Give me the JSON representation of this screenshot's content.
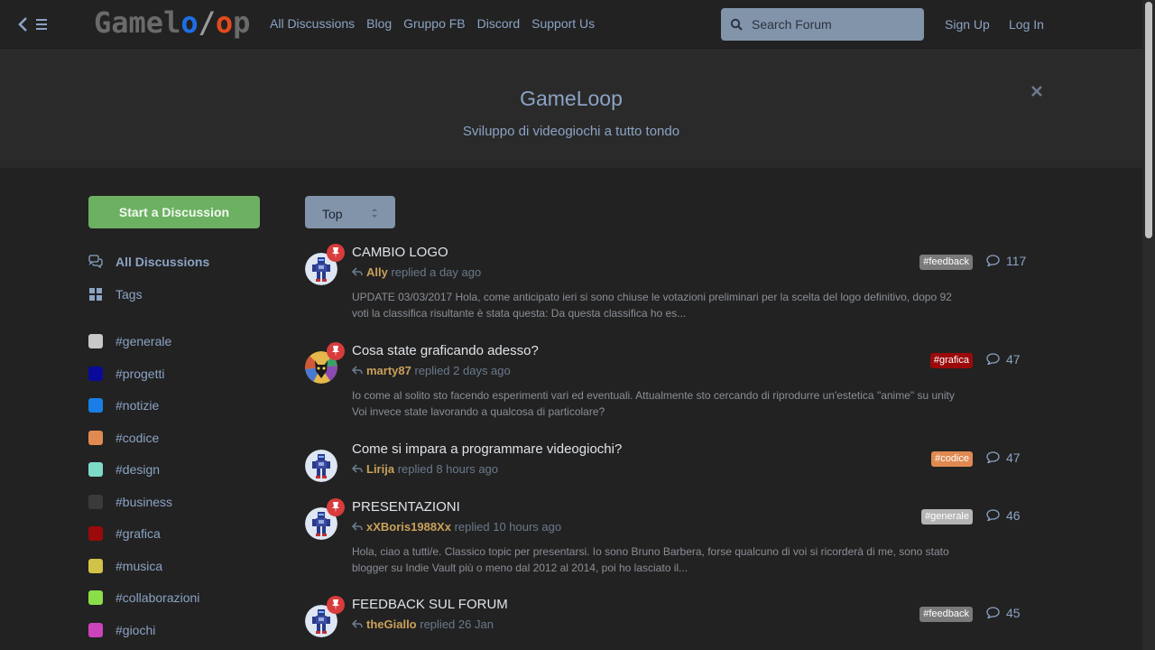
{
  "header": {
    "logo": {
      "part1": "Gamel",
      "o1": "o",
      "slash": "/",
      "o2": "o",
      "part2": "p"
    },
    "nav": [
      "All Discussions",
      "Blog",
      "Gruppo FB",
      "Discord",
      "Support Us"
    ],
    "search_placeholder": "Search Forum",
    "sign_up": "Sign Up",
    "log_in": "Log In"
  },
  "hero": {
    "title": "GameLoop",
    "subtitle": "Sviluppo di videogiochi a tutto tondo"
  },
  "sidebar": {
    "start_label": "Start a Discussion",
    "all_discussions": "All Discussions",
    "tags_label": "Tags",
    "tags": [
      {
        "label": "#generale",
        "color": "#c8c8c8"
      },
      {
        "label": "#progetti",
        "color": "#0a0a9a"
      },
      {
        "label": "#notizie",
        "color": "#1a7ee6"
      },
      {
        "label": "#codice",
        "color": "#e08a52"
      },
      {
        "label": "#design",
        "color": "#7edac8"
      },
      {
        "label": "#business",
        "color": "#3a3a3a"
      },
      {
        "label": "#grafica",
        "color": "#9a0a0a"
      },
      {
        "label": "#musica",
        "color": "#d2c24a"
      },
      {
        "label": "#collaborazioni",
        "color": "#8ade4a"
      },
      {
        "label": "#giochi",
        "color": "#cc44bc"
      }
    ]
  },
  "sort": {
    "label": "Top"
  },
  "discussions": [
    {
      "title": "CAMBIO LOGO",
      "user": "Ally",
      "when": "replied a day ago",
      "excerpt": "UPDATE 03/03/2017 Hola, come anticipato ieri si sono chiuse le votazioni preliminari per la scelta del logo definitivo, dopo 92 voti la classifica risultante è stata questa: Da questa classifica ho es...",
      "tag": "#feedback",
      "tag_color": "#7a7a7a",
      "count": "117",
      "pinned": true,
      "avatar": "robot"
    },
    {
      "title": "Cosa state graficando adesso?",
      "user": "marty87",
      "when": "replied 2 days ago",
      "excerpt": "Io come al solito sto facendo esperimenti vari ed eventuali. Attualmente sto cercando di riprodurre un'estetica \"anime\" su unity Voi invece state lavorando a qualcosa di particolare?",
      "tag": "#grafica",
      "tag_color": "#9a0a0a",
      "count": "47",
      "pinned": true,
      "avatar": "cat"
    },
    {
      "title": "Come si impara a programmare videogiochi?",
      "user": "Lirija",
      "when": "replied 8 hours ago",
      "excerpt": "",
      "tag": "#codice",
      "tag_color": "#e08a52",
      "count": "47",
      "pinned": false,
      "avatar": "robot"
    },
    {
      "title": "PRESENTAZIONI",
      "user": "xXBoris1988Xx",
      "when": "replied 10 hours ago",
      "excerpt": "Hola, ciao a tutti/e. Classico topic per presentarsi. Io sono Bruno Barbera, forse qualcuno di voi si ricorderà di me, sono stato blogger su Indie Vault più o meno dal 2012 al 2014, poi ho lasciato il...",
      "tag": "#generale",
      "tag_color": "#b4b4b4",
      "count": "46",
      "pinned": true,
      "avatar": "robot"
    },
    {
      "title": "FEEDBACK SUL FORUM",
      "user": "theGiallo",
      "when": "replied 26 Jan",
      "excerpt": "",
      "tag": "#feedback",
      "tag_color": "#7a7a7a",
      "count": "45",
      "pinned": true,
      "avatar": "robot"
    }
  ]
}
